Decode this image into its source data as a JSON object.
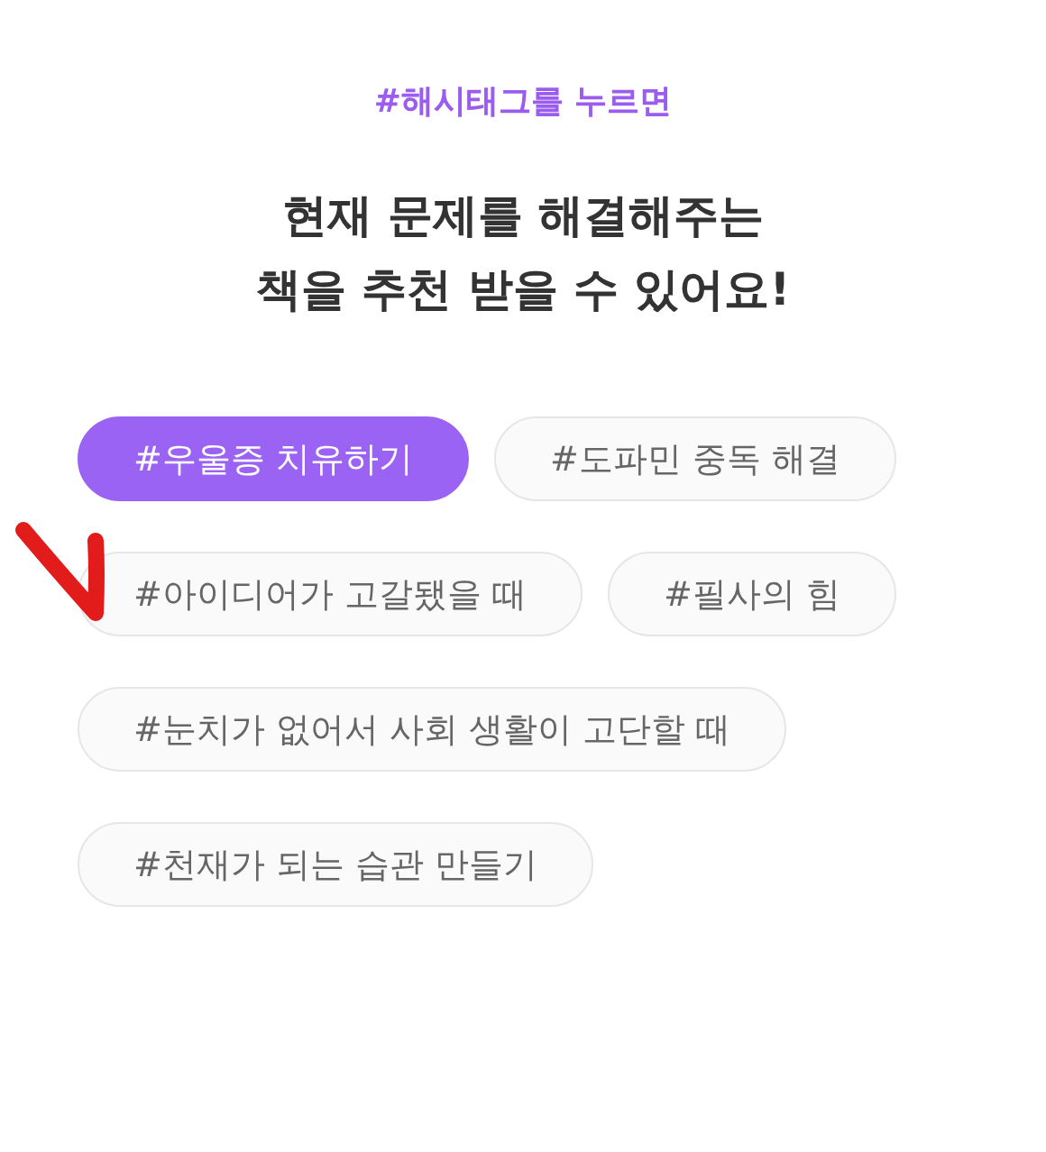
{
  "eyebrow": "#해시태그를 누르면",
  "title_lines": [
    "현재 문제를 해결해주는",
    "책을 추천 받을 수 있어요!"
  ],
  "tag_rows": [
    [
      {
        "label": "#우울증 치유하기",
        "selected": true,
        "marked": false
      },
      {
        "label": "#도파민 중독 해결",
        "selected": false,
        "marked": false
      }
    ],
    [
      {
        "label": "#아이디어가 고갈됐을 때",
        "selected": false,
        "marked": true
      },
      {
        "label": "#필사의 힘",
        "selected": false,
        "marked": false
      }
    ],
    [
      {
        "label": "#눈치가 없어서 사회 생활이 고단할 때",
        "selected": false,
        "marked": false
      }
    ],
    [
      {
        "label": "#천재가 되는 습관 만들기",
        "selected": false,
        "marked": false
      }
    ]
  ]
}
